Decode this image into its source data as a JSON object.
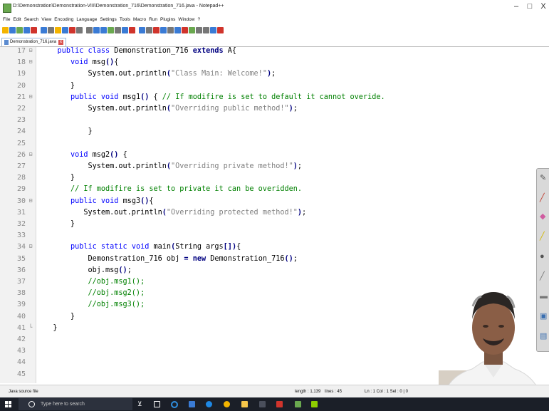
{
  "window": {
    "title": "D:\\Demonstration\\Demonstration-VIII\\Demonstration_716\\Demonstration_716.java - Notepad++",
    "controls": [
      "–",
      "□",
      "X"
    ]
  },
  "menu": [
    "File",
    "Edit",
    "Search",
    "View",
    "Encoding",
    "Language",
    "Settings",
    "Tools",
    "Macro",
    "Run",
    "Plugins",
    "Window",
    "?"
  ],
  "tab": {
    "label": "Demonstration_716.java",
    "close": "x"
  },
  "editor": {
    "lines": [
      {
        "n": "17",
        "fold": "⊟",
        "tokens": [
          [
            "",
            "    "
          ],
          [
            "kw",
            "public"
          ],
          [
            "",
            " "
          ],
          [
            "kw",
            "class"
          ],
          [
            "",
            " Demonstration_716 "
          ],
          [
            "kwb",
            "extends"
          ],
          [
            "",
            " A{"
          ]
        ]
      },
      {
        "n": "18",
        "fold": "⊟",
        "tokens": [
          [
            "",
            "       "
          ],
          [
            "kw",
            "void"
          ],
          [
            "",
            " msg"
          ],
          [
            "op",
            "()"
          ],
          [
            "",
            "{"
          ]
        ]
      },
      {
        "n": "19",
        "fold": "",
        "tokens": [
          [
            "",
            "           System.out.println"
          ],
          [
            "op",
            "("
          ],
          [
            "str",
            "\"Class Main: Welcome!\""
          ],
          [
            "op",
            ")"
          ],
          [
            "",
            ";"
          ]
        ]
      },
      {
        "n": "20",
        "fold": "",
        "tokens": [
          [
            "",
            "       }"
          ]
        ]
      },
      {
        "n": "21",
        "fold": "⊟",
        "tokens": [
          [
            "",
            "       "
          ],
          [
            "kw",
            "public"
          ],
          [
            "",
            " "
          ],
          [
            "kw",
            "void"
          ],
          [
            "",
            " msg1"
          ],
          [
            "op",
            "()"
          ],
          [
            "",
            " { "
          ],
          [
            "cm",
            "// If modifire is set to default it cannot overide."
          ]
        ]
      },
      {
        "n": "22",
        "fold": "",
        "tokens": [
          [
            "",
            "           System.out.println"
          ],
          [
            "op",
            "("
          ],
          [
            "str",
            "\"Overriding public method!\""
          ],
          [
            "op",
            ")"
          ],
          [
            "",
            ";"
          ]
        ]
      },
      {
        "n": "23",
        "fold": "",
        "tokens": []
      },
      {
        "n": "24",
        "fold": "",
        "tokens": [
          [
            "",
            "           }"
          ]
        ]
      },
      {
        "n": "25",
        "fold": "",
        "tokens": []
      },
      {
        "n": "26",
        "fold": "⊟",
        "tokens": [
          [
            "",
            "       "
          ],
          [
            "kw",
            "void"
          ],
          [
            "",
            " msg2"
          ],
          [
            "op",
            "()"
          ],
          [
            "",
            " {"
          ]
        ]
      },
      {
        "n": "27",
        "fold": "",
        "tokens": [
          [
            "",
            "           System.out.println"
          ],
          [
            "op",
            "("
          ],
          [
            "str",
            "\"Overriding private method!\""
          ],
          [
            "op",
            ")"
          ],
          [
            "",
            ";"
          ]
        ]
      },
      {
        "n": "28",
        "fold": "",
        "tokens": [
          [
            "",
            "       }"
          ]
        ]
      },
      {
        "n": "29",
        "fold": "",
        "tokens": [
          [
            "",
            "       "
          ],
          [
            "cm",
            "// If modifire is set to private it can be overidden."
          ]
        ]
      },
      {
        "n": "30",
        "fold": "⊟",
        "tokens": [
          [
            "",
            "       "
          ],
          [
            "kw",
            "public"
          ],
          [
            "",
            " "
          ],
          [
            "kw",
            "void"
          ],
          [
            "",
            " msg3"
          ],
          [
            "op",
            "()"
          ],
          [
            "",
            "{"
          ]
        ]
      },
      {
        "n": "31",
        "fold": "",
        "tokens": [
          [
            "",
            "          System.out.println"
          ],
          [
            "op",
            "("
          ],
          [
            "str",
            "\"Overriding protected method!\""
          ],
          [
            "op",
            ")"
          ],
          [
            "",
            ";"
          ]
        ]
      },
      {
        "n": "32",
        "fold": "",
        "tokens": [
          [
            "",
            "       }"
          ]
        ]
      },
      {
        "n": "33",
        "fold": "",
        "tokens": []
      },
      {
        "n": "34",
        "fold": "⊟",
        "tokens": [
          [
            "",
            "       "
          ],
          [
            "kw",
            "public"
          ],
          [
            "",
            " "
          ],
          [
            "kw",
            "static"
          ],
          [
            "",
            " "
          ],
          [
            "kw",
            "void"
          ],
          [
            "",
            " main"
          ],
          [
            "op",
            "("
          ],
          [
            "",
            "String args"
          ],
          [
            "op",
            "[]"
          ],
          [
            "op",
            ")"
          ],
          [
            "",
            "{"
          ]
        ]
      },
      {
        "n": "35",
        "fold": "",
        "tokens": [
          [
            "",
            "           Demonstration_716 obj "
          ],
          [
            "op",
            "="
          ],
          [
            "",
            " "
          ],
          [
            "kwb",
            "new"
          ],
          [
            "",
            " Demonstration_716"
          ],
          [
            "op",
            "()"
          ],
          [
            "",
            ";"
          ]
        ]
      },
      {
        "n": "36",
        "fold": "",
        "tokens": [
          [
            "",
            "           obj.msg"
          ],
          [
            "op",
            "()"
          ],
          [
            "",
            ";"
          ]
        ]
      },
      {
        "n": "37",
        "fold": "",
        "tokens": [
          [
            "",
            "           "
          ],
          [
            "cm",
            "//obj.msg1();"
          ]
        ]
      },
      {
        "n": "38",
        "fold": "",
        "tokens": [
          [
            "",
            "           "
          ],
          [
            "cm",
            "//obj.msg2();"
          ]
        ]
      },
      {
        "n": "39",
        "fold": "",
        "tokens": [
          [
            "",
            "           "
          ],
          [
            "cm",
            "//obj.msg3();"
          ]
        ]
      },
      {
        "n": "40",
        "fold": "",
        "tokens": [
          [
            "",
            "       }"
          ]
        ]
      },
      {
        "n": "41",
        "fold": "└",
        "tokens": [
          [
            "",
            "   }"
          ]
        ]
      },
      {
        "n": "42",
        "fold": "",
        "tokens": []
      },
      {
        "n": "43",
        "fold": "",
        "tokens": []
      },
      {
        "n": "44",
        "fold": "",
        "tokens": []
      },
      {
        "n": "45",
        "fold": "",
        "tokens": []
      }
    ]
  },
  "status": {
    "lang": "Java source file",
    "length": "length : 1,139",
    "lines": "lines : 45",
    "pos": "Ln : 1   Col : 1   Sel : 0 | 0"
  },
  "taskbar": {
    "search_placeholder": "Type here to search"
  },
  "colors": {
    "keyword": "#0000ff",
    "comment": "#008000",
    "string": "#808080",
    "taskbar": "#1b1f28"
  }
}
